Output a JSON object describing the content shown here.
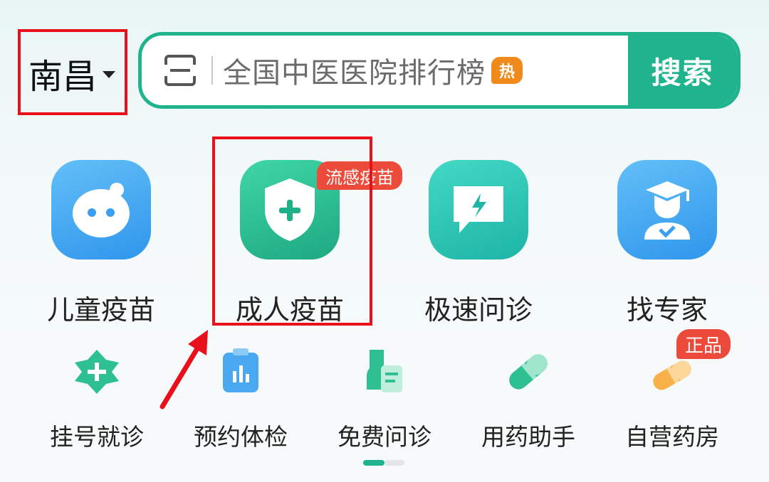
{
  "header": {
    "city": "南昌",
    "search_placeholder": "全国中医医院排行榜",
    "hot_badge": "热",
    "search_button": "搜索"
  },
  "big_entries": [
    {
      "label": "儿童疫苗",
      "icon": "baby-face-icon"
    },
    {
      "label": "成人疫苗",
      "icon": "shield-plus-icon",
      "badge": "流感疫苗"
    },
    {
      "label": "极速问诊",
      "icon": "chat-lightning-icon"
    },
    {
      "label": "找专家",
      "icon": "doctor-graduate-icon"
    }
  ],
  "small_entries": [
    {
      "label": "挂号就诊",
      "icon": "medical-cross-icon"
    },
    {
      "label": "预约体检",
      "icon": "clipboard-chart-icon"
    },
    {
      "label": "免费问诊",
      "icon": "stethoscope-doc-icon"
    },
    {
      "label": "用药助手",
      "icon": "pill-capsule-icon"
    },
    {
      "label": "自营药房",
      "icon": "pill-store-icon",
      "badge": "正品"
    }
  ],
  "pagination": {
    "pages": 2,
    "current": 1
  },
  "colors": {
    "brand": "#1fb38e",
    "highlight": "#e8101a",
    "badge": "#ec4a3a",
    "hot": "#f08a1a"
  }
}
